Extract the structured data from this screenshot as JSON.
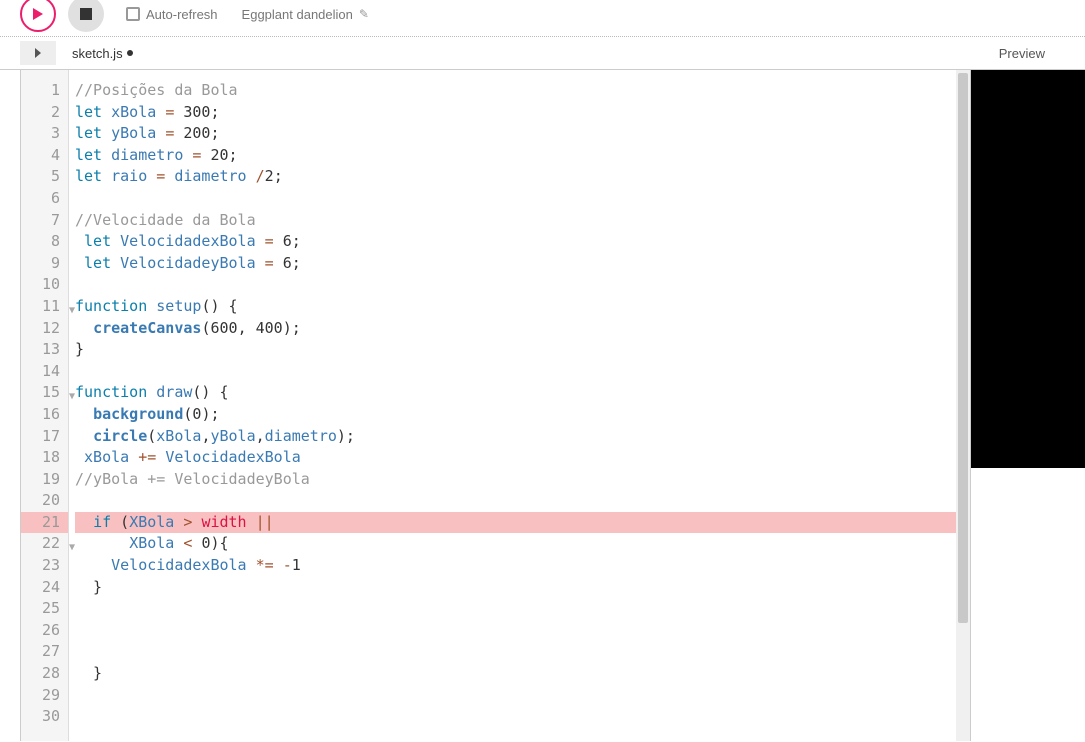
{
  "toolbar": {
    "auto_refresh_label": "Auto-refresh",
    "sketch_name": "Eggplant dandelion"
  },
  "tabs": {
    "filename": "sketch.js",
    "preview_label": "Preview"
  },
  "code": {
    "lines": [
      {
        "n": 1,
        "tokens": [
          {
            "t": "//Posições da Bola",
            "c": "cm"
          }
        ]
      },
      {
        "n": 2,
        "tokens": [
          {
            "t": "let",
            "c": "kw"
          },
          {
            "t": " "
          },
          {
            "t": "xBola",
            "c": "var"
          },
          {
            "t": " "
          },
          {
            "t": "=",
            "c": "op"
          },
          {
            "t": " "
          },
          {
            "t": "300",
            "c": "num"
          },
          {
            "t": ";"
          }
        ]
      },
      {
        "n": 3,
        "tokens": [
          {
            "t": "let",
            "c": "kw"
          },
          {
            "t": " "
          },
          {
            "t": "yBola",
            "c": "var"
          },
          {
            "t": " "
          },
          {
            "t": "=",
            "c": "op"
          },
          {
            "t": " "
          },
          {
            "t": "200",
            "c": "num"
          },
          {
            "t": ";"
          }
        ]
      },
      {
        "n": 4,
        "tokens": [
          {
            "t": "let",
            "c": "kw"
          },
          {
            "t": " "
          },
          {
            "t": "diametro",
            "c": "var"
          },
          {
            "t": " "
          },
          {
            "t": "=",
            "c": "op"
          },
          {
            "t": " "
          },
          {
            "t": "20",
            "c": "num"
          },
          {
            "t": ";"
          }
        ]
      },
      {
        "n": 5,
        "tokens": [
          {
            "t": "let",
            "c": "kw"
          },
          {
            "t": " "
          },
          {
            "t": "raio",
            "c": "var"
          },
          {
            "t": " "
          },
          {
            "t": "=",
            "c": "op"
          },
          {
            "t": " "
          },
          {
            "t": "diametro",
            "c": "var"
          },
          {
            "t": " "
          },
          {
            "t": "/",
            "c": "op"
          },
          {
            "t": "2",
            "c": "num"
          },
          {
            "t": ";"
          }
        ]
      },
      {
        "n": 6,
        "tokens": []
      },
      {
        "n": 7,
        "tokens": [
          {
            "t": "//Velocidade da Bola",
            "c": "cm"
          }
        ]
      },
      {
        "n": 8,
        "tokens": [
          {
            "t": " "
          },
          {
            "t": "let",
            "c": "kw"
          },
          {
            "t": " "
          },
          {
            "t": "VelocidadexBola",
            "c": "var"
          },
          {
            "t": " "
          },
          {
            "t": "=",
            "c": "op"
          },
          {
            "t": " "
          },
          {
            "t": "6",
            "c": "num"
          },
          {
            "t": ";"
          }
        ]
      },
      {
        "n": 9,
        "tokens": [
          {
            "t": " "
          },
          {
            "t": "let",
            "c": "kw"
          },
          {
            "t": " "
          },
          {
            "t": "VelocidadeyBola",
            "c": "var"
          },
          {
            "t": " "
          },
          {
            "t": "=",
            "c": "op"
          },
          {
            "t": " "
          },
          {
            "t": "6",
            "c": "num"
          },
          {
            "t": ";"
          }
        ]
      },
      {
        "n": 10,
        "tokens": []
      },
      {
        "n": 11,
        "fold": true,
        "tokens": [
          {
            "t": "function",
            "c": "kw"
          },
          {
            "t": " "
          },
          {
            "t": "setup",
            "c": "fn"
          },
          {
            "t": "() {"
          }
        ]
      },
      {
        "n": 12,
        "tokens": [
          {
            "t": "  "
          },
          {
            "t": "createCanvas",
            "c": "call"
          },
          {
            "t": "("
          },
          {
            "t": "600",
            "c": "num"
          },
          {
            "t": ", "
          },
          {
            "t": "400",
            "c": "num"
          },
          {
            "t": ");"
          }
        ]
      },
      {
        "n": 13,
        "tokens": [
          {
            "t": "}"
          }
        ]
      },
      {
        "n": 14,
        "tokens": []
      },
      {
        "n": 15,
        "fold": true,
        "tokens": [
          {
            "t": "function",
            "c": "kw"
          },
          {
            "t": " "
          },
          {
            "t": "draw",
            "c": "fn"
          },
          {
            "t": "() {"
          }
        ]
      },
      {
        "n": 16,
        "tokens": [
          {
            "t": "  "
          },
          {
            "t": "background",
            "c": "call"
          },
          {
            "t": "("
          },
          {
            "t": "0",
            "c": "num"
          },
          {
            "t": ");"
          }
        ]
      },
      {
        "n": 17,
        "tokens": [
          {
            "t": "  "
          },
          {
            "t": "circle",
            "c": "call"
          },
          {
            "t": "("
          },
          {
            "t": "xBola",
            "c": "var"
          },
          {
            "t": ","
          },
          {
            "t": "yBola",
            "c": "var"
          },
          {
            "t": ","
          },
          {
            "t": "diametro",
            "c": "var"
          },
          {
            "t": ");"
          }
        ]
      },
      {
        "n": 18,
        "tokens": [
          {
            "t": " "
          },
          {
            "t": "xBola",
            "c": "var"
          },
          {
            "t": " "
          },
          {
            "t": "+=",
            "c": "op"
          },
          {
            "t": " "
          },
          {
            "t": "VelocidadexBola",
            "c": "var"
          }
        ]
      },
      {
        "n": 19,
        "tokens": [
          {
            "t": "//yBola += VelocidadeyBola",
            "c": "cm"
          }
        ]
      },
      {
        "n": 20,
        "tokens": []
      },
      {
        "n": 21,
        "error": true,
        "tokens": [
          {
            "t": "  "
          },
          {
            "t": "if",
            "c": "kw"
          },
          {
            "t": " ("
          },
          {
            "t": "XBola",
            "c": "var"
          },
          {
            "t": " "
          },
          {
            "t": ">",
            "c": "op"
          },
          {
            "t": " "
          },
          {
            "t": "width",
            "c": "err"
          },
          {
            "t": " "
          },
          {
            "t": "||",
            "c": "op"
          }
        ]
      },
      {
        "n": 22,
        "fold": true,
        "tokens": [
          {
            "t": "      "
          },
          {
            "t": "XBola",
            "c": "var"
          },
          {
            "t": " "
          },
          {
            "t": "<",
            "c": "op"
          },
          {
            "t": " "
          },
          {
            "t": "0",
            "c": "num"
          },
          {
            "t": "){"
          }
        ]
      },
      {
        "n": 23,
        "tokens": [
          {
            "t": "    "
          },
          {
            "t": "VelocidadexBola",
            "c": "var"
          },
          {
            "t": " "
          },
          {
            "t": "*=",
            "c": "op"
          },
          {
            "t": " "
          },
          {
            "t": "-",
            "c": "op"
          },
          {
            "t": "1",
            "c": "num"
          }
        ]
      },
      {
        "n": 24,
        "tokens": [
          {
            "t": "  }"
          }
        ]
      },
      {
        "n": 25,
        "tokens": []
      },
      {
        "n": 26,
        "tokens": []
      },
      {
        "n": 27,
        "tokens": []
      },
      {
        "n": 28,
        "tokens": [
          {
            "t": "  }"
          }
        ]
      },
      {
        "n": 29,
        "tokens": []
      },
      {
        "n": 30,
        "tokens": []
      }
    ]
  }
}
